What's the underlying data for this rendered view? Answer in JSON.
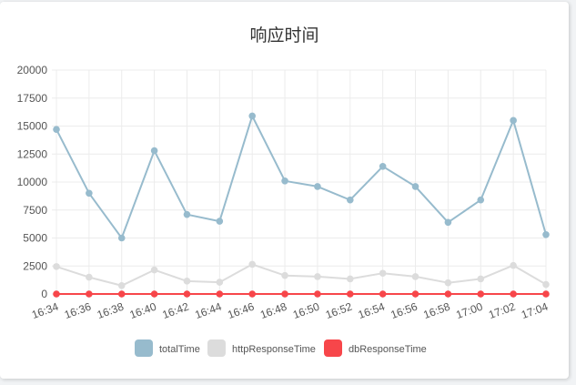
{
  "chart_data": {
    "type": "line",
    "title": "响应时间",
    "xlabel": "",
    "ylabel": "",
    "x": [
      "16:34",
      "16:36",
      "16:38",
      "16:40",
      "16:42",
      "16:44",
      "16:46",
      "16:48",
      "16:50",
      "16:52",
      "16:54",
      "16:56",
      "16:58",
      "17:00",
      "17:02",
      "17:04"
    ],
    "ylim": [
      0,
      20000
    ],
    "yticks": [
      0,
      2500,
      5000,
      7500,
      10000,
      12500,
      15000,
      17500,
      20000
    ],
    "grid": true,
    "legend_position": "bottom",
    "series": [
      {
        "name": "totalTime",
        "color": "#97bbcd",
        "values": [
          14700,
          9000,
          5000,
          12800,
          7100,
          6500,
          15900,
          10100,
          9600,
          8400,
          11400,
          9600,
          6400,
          8400,
          15500,
          5300
        ]
      },
      {
        "name": "httpResponseTime",
        "color": "#dcdcdc",
        "values": [
          2450,
          1500,
          750,
          2150,
          1150,
          1050,
          2650,
          1650,
          1550,
          1350,
          1850,
          1550,
          1000,
          1350,
          2550,
          850
        ]
      },
      {
        "name": "dbResponseTime",
        "color": "#f7464a",
        "values": [
          0,
          0,
          0,
          0,
          0,
          0,
          0,
          0,
          0,
          0,
          0,
          0,
          0,
          0,
          0,
          0
        ]
      }
    ]
  }
}
